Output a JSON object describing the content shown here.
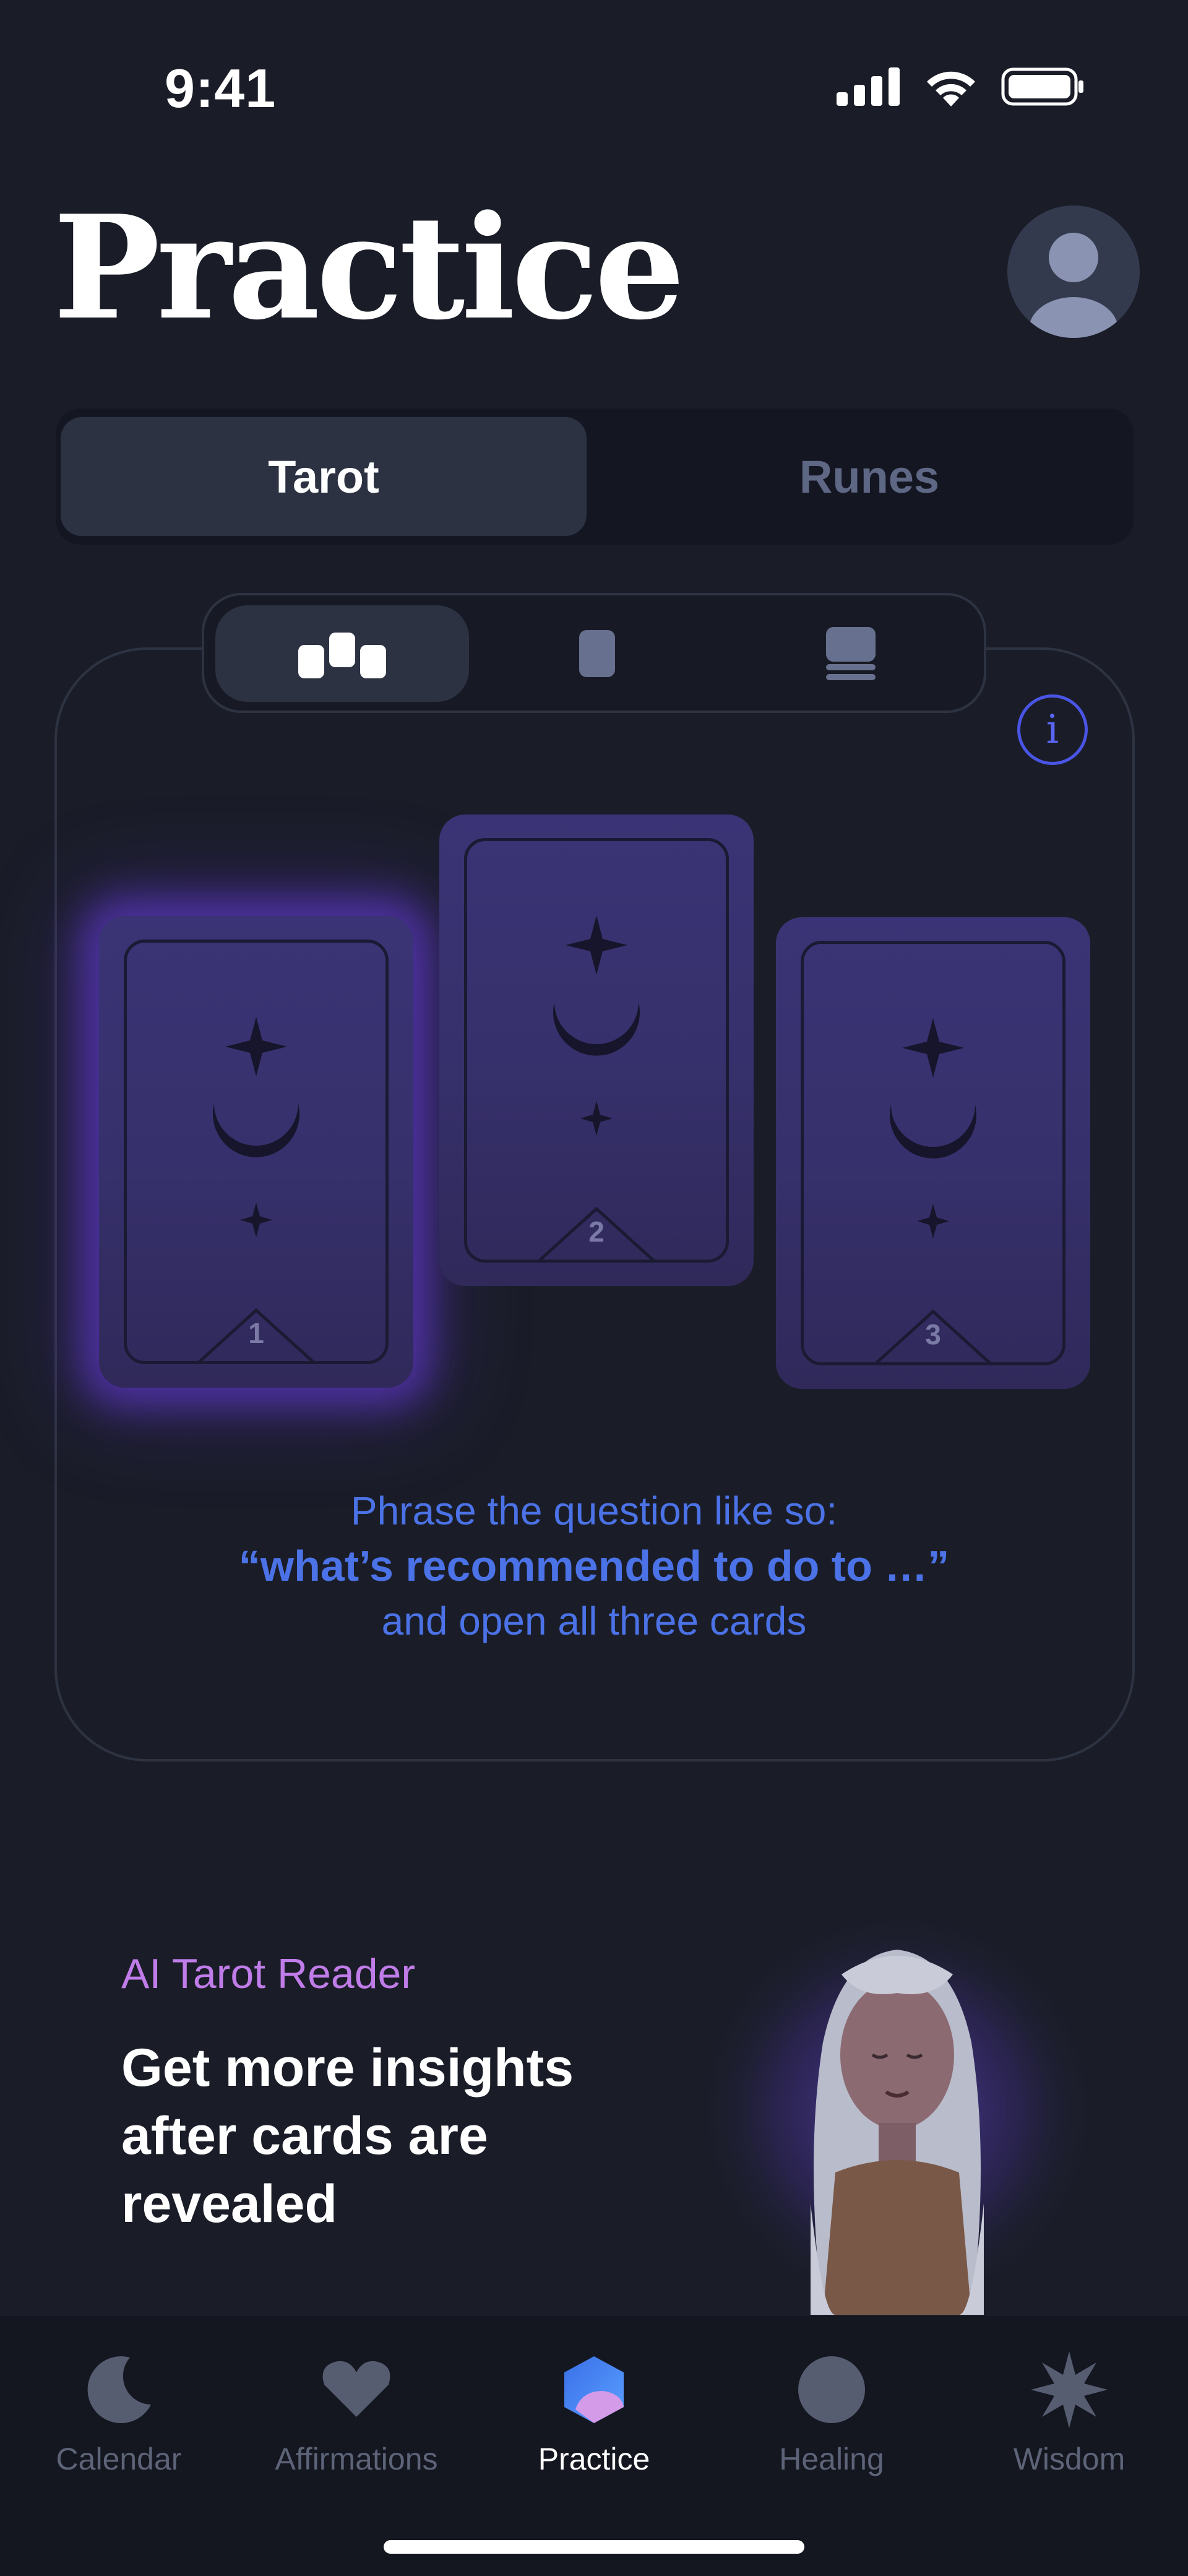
{
  "status_bar": {
    "time": "9:41"
  },
  "header": {
    "title": "Practice"
  },
  "segment": {
    "tabs": [
      "Tarot",
      "Runes"
    ],
    "active": "Tarot"
  },
  "layout_switch": {
    "options": [
      "three-cards-icon",
      "single-card-icon",
      "deck-stack-icon"
    ],
    "active": "three-cards-icon"
  },
  "cards": [
    {
      "number": "1",
      "highlighted": true
    },
    {
      "number": "2",
      "highlighted": false
    },
    {
      "number": "3",
      "highlighted": false
    }
  ],
  "hint": {
    "line1": "Phrase the question like so:",
    "line2": "“what’s recommended to do to …”",
    "line3": "and open all three cards"
  },
  "promo": {
    "tag": "AI Tarot Reader",
    "title": "Get more insights after cards are revealed"
  },
  "tabbar": {
    "items": [
      {
        "label": "Calendar",
        "icon": "moon-icon"
      },
      {
        "label": "Affirmations",
        "icon": "heart-icon"
      },
      {
        "label": "Practice",
        "icon": "practice-hexagon-icon"
      },
      {
        "label": "Healing",
        "icon": "circle-icon"
      },
      {
        "label": "Wisdom",
        "icon": "star-burst-icon"
      }
    ],
    "active": "Practice"
  },
  "colors": {
    "background": "#1a1d28",
    "accent_blue": "#4b72e6",
    "accent_purple": "#c07ce8",
    "card_purple": "#3a3476"
  }
}
